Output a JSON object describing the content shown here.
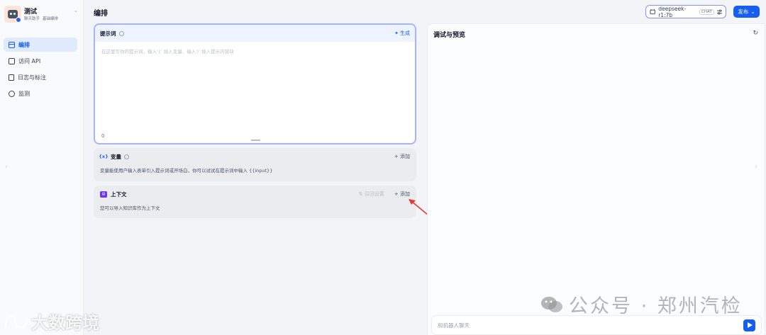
{
  "app": {
    "name": "测试",
    "tags": [
      "聊天助手",
      "基础编排"
    ]
  },
  "nav": {
    "items": [
      {
        "label": "编排",
        "active": true
      },
      {
        "label": "访问 API"
      },
      {
        "label": "日志与标注"
      },
      {
        "label": "监测"
      }
    ]
  },
  "header": {
    "title": "编排",
    "model": "deepseek-r1:7b",
    "model_mode": "CHAT",
    "publish": "发布"
  },
  "prompt": {
    "title": "提示词",
    "generate": "生成",
    "placeholder": "在这里写你的提示词，输入'{' 插入变量、输入'/' 插入提示内容块",
    "char_count": "0"
  },
  "variables": {
    "title": "变量",
    "add": "添加",
    "desc": "变量能使用户输入表单引入提示词或开场白，你可以试试在提示词中输入 {{input}}"
  },
  "context": {
    "title": "上下文",
    "recall": "召回设置",
    "add": "添加",
    "desc": "您可以导入知识库作为上下文"
  },
  "preview": {
    "title": "调试与预览",
    "chat_placeholder": "和机器人聊天"
  },
  "watermarks": {
    "wechat": "公众号 · 郑州汽检",
    "corner": "大数跨境"
  },
  "colors": {
    "accent": "#155eef",
    "arrow": "#e53935"
  }
}
